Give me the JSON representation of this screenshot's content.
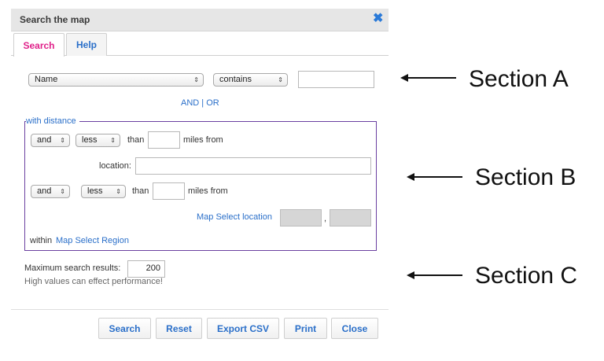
{
  "dialog": {
    "title": "Search the map",
    "close_glyph": "✖"
  },
  "tabs": [
    {
      "label": "Search",
      "active": true
    },
    {
      "label": "Help",
      "active": false
    }
  ],
  "section_a": {
    "field_select": "Name",
    "operator_select": "contains",
    "value_input": "",
    "and_or_link": "AND | OR"
  },
  "distance": {
    "legend": "with distance",
    "row1": {
      "logic": "and",
      "comparator": "less",
      "than": "than",
      "miles_value": "",
      "miles_from": "miles from"
    },
    "location_label": "location:",
    "location_value": "",
    "row2": {
      "logic": "and",
      "comparator": "less",
      "than": "than",
      "miles_value": "",
      "miles_from": "miles from"
    },
    "map_select_location": "Map Select location",
    "coord_separator": ",",
    "within_label": "within",
    "map_select_region": "Map Select Region"
  },
  "section_c": {
    "max_results_label": "Maximum search results:",
    "max_results_value": "200",
    "performance_note": "High values can effect performance!"
  },
  "buttons": {
    "search": "Search",
    "reset": "Reset",
    "export_csv": "Export CSV",
    "print": "Print",
    "close": "Close"
  },
  "annotations": {
    "section_a": "Section A",
    "section_b": "Section B",
    "section_c": "Section C"
  },
  "colors": {
    "accent_link": "#2a6fc9",
    "active_tab": "#e0218a",
    "fieldset_border": "#6a3fa0"
  }
}
